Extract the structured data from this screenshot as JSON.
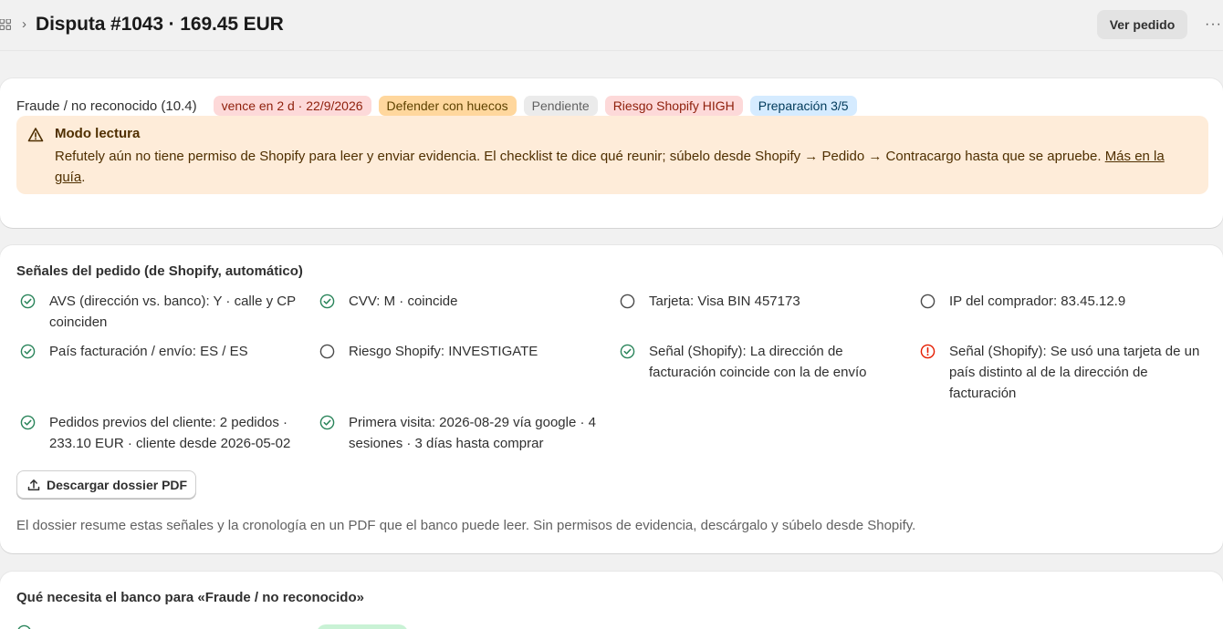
{
  "header": {
    "title": "Disputa #1043 · 169.45 EUR",
    "view_order_label": "Ver pedido",
    "breadcrumb_icon": "apps-grid-icon",
    "more_icon": "more-horizontal-icon"
  },
  "status": {
    "reason": "Fraude / no reconocido (10.4)",
    "badges": [
      {
        "label": "vence en 2 d · 22/9/2026",
        "tone": "critical"
      },
      {
        "label": "Defender con huecos",
        "tone": "warning"
      },
      {
        "label": "Pendiente",
        "tone": "neutral"
      },
      {
        "label": "Riesgo Shopify HIGH",
        "tone": "critical"
      },
      {
        "label": "Preparación 3/5",
        "tone": "info"
      }
    ]
  },
  "banner": {
    "icon": "warning-triangle-icon",
    "title": "Modo lectura",
    "text": "Refutely aún no tiene permiso de Shopify para leer y enviar evidencia. El checklist te dice qué reunir; súbelo desde Shopify → Pedido → Contracargo hasta que se apruebe. ",
    "link_label": "Más en la guía",
    "trailing": "."
  },
  "signals": {
    "title": "Señales del pedido (de Shopify, automático)",
    "items": [
      {
        "text": "AVS (dirección vs. banco): Y · calle y CP coinciden",
        "state": "ok"
      },
      {
        "text": "CVV: M · coincide",
        "state": "ok"
      },
      {
        "text": "Tarjeta: Visa BIN 457173",
        "state": "neutral"
      },
      {
        "text": "IP del comprador: 83.45.12.9",
        "state": "neutral"
      },
      {
        "text": "País facturación / envío: ES / ES",
        "state": "ok"
      },
      {
        "text": "Riesgo Shopify: INVESTIGATE",
        "state": "neutral"
      },
      {
        "text": "Señal (Shopify): La dirección de facturación coincide con la de envío",
        "state": "ok"
      },
      {
        "text": "Señal (Shopify): Se usó una tarjeta de un país distinto al de la dirección de facturación",
        "state": "alert"
      },
      {
        "text": "Pedidos previos del cliente: 2 pedidos · 233.10 EUR · cliente desde 2026-05-02",
        "state": "ok"
      },
      {
        "text": "Primera visita: 2026-08-29 vía google · 4 sesiones · 3 días hasta comprar",
        "state": "ok"
      }
    ],
    "download_label": "Descargar dossier PDF",
    "note": "El dossier resume estas señales y la cronología en un PDF que el banco puede leer. Sin permisos de evidencia, descárgalo y súbelo desde Shopify."
  },
  "bank": {
    "title": "Qué necesita el banco para «Fraude / no reconocido»"
  },
  "colors": {
    "ok": "#29845a",
    "alert": "#e51c00",
    "neutral": "#4a4a4a",
    "banner_bg": "#feecd9"
  }
}
